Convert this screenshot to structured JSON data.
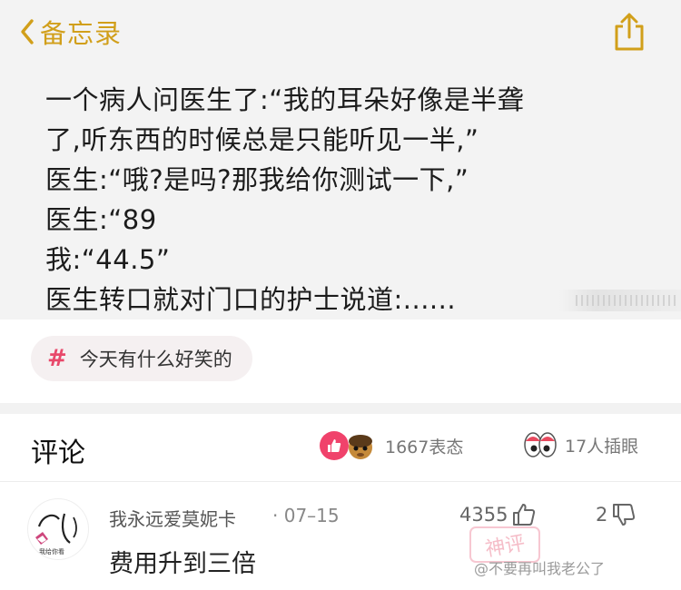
{
  "note": {
    "back_label": "备忘录",
    "lines": [
      "一个病人问医生了:“我的耳朵好像是半聋",
      "了,听东西的时候总是只能听见一半,”",
      "医生:“哦?是吗?那我给你测试一下,”",
      "医生:“89",
      "我:“44.5”",
      "医生转口就对门口的护士说道:......"
    ]
  },
  "topic": {
    "label": "今天有什么好笑的"
  },
  "comments_header": {
    "title": "评论",
    "reactions_count": "1667表态",
    "eyes_count": "17人插眼"
  },
  "comment": {
    "username": "我永远爱莫妮卡",
    "date": "· 07–15",
    "likes": "4355",
    "dislikes": "2",
    "text": "费用升到三倍",
    "avatar_caption": "我给你看"
  },
  "watermark": "@不要再叫我老公了",
  "stamp_text": "神评",
  "colors": {
    "accent_notes": "#d19f1a",
    "accent_weibo": "#f0426b"
  }
}
